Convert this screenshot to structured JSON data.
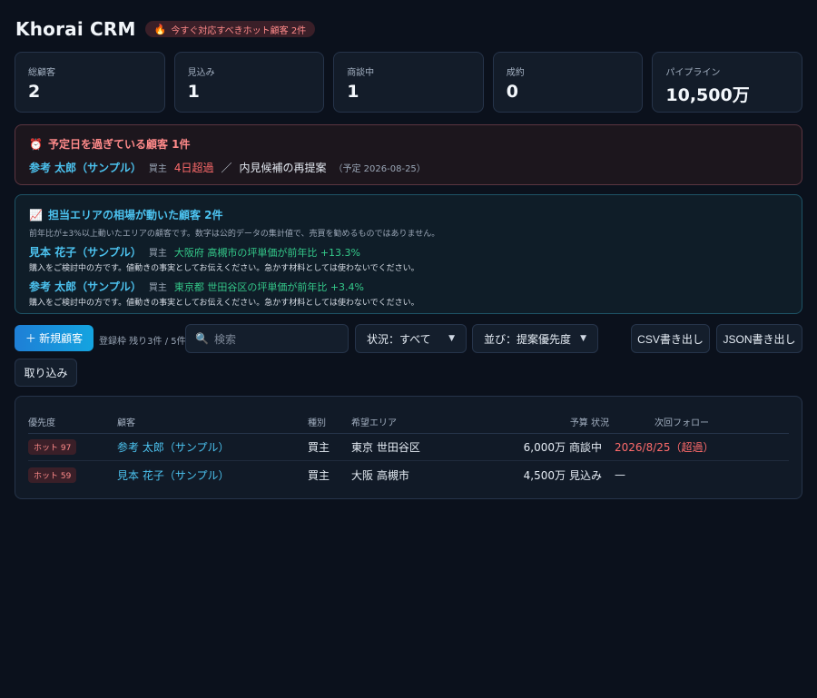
{
  "app": {
    "title": "Khorai CRM",
    "hot_badge": "今すぐ対応すべきホット顧客 2件"
  },
  "stats": [
    {
      "label": "総顧客",
      "value": "2"
    },
    {
      "label": "見込み",
      "value": "1"
    },
    {
      "label": "商談中",
      "value": "1"
    },
    {
      "label": "成約",
      "value": "0"
    },
    {
      "label": "パイプライン",
      "value": "10,500万"
    }
  ],
  "overdue": {
    "title": "予定日を過ぎている顧客 1件",
    "customer": "参考 太郎（サンプル）",
    "kind": "買主",
    "overdue_tag": "4日超過",
    "separator": "／",
    "action": "内見候補の再提案",
    "due": "（予定 2026-08-25）"
  },
  "market": {
    "title": "担当エリアの相場が動いた顧客 2件",
    "note": "前年比が±3%以上動いたエリアの顧客です。数字は公的データの集計値で、売買を勧めるものではありません。",
    "items": [
      {
        "customer": "見本 花子（サンプル）",
        "kind": "買主",
        "change": "大阪府 高槻市の坪単価が前年比 +13.3%",
        "sub": "購入をご検討中の方です。値動きの事実としてお伝えください。急かす材料としては使わないでください。"
      },
      {
        "customer": "参考 太郎（サンプル）",
        "kind": "買主",
        "change": "東京都 世田谷区の坪単価が前年比 +3.4%",
        "sub": "購入をご検討中の方です。値動きの事実としてお伝えください。急かす材料としては使わないでください。"
      }
    ]
  },
  "toolbar": {
    "new_customer": "＋ 新規顧客",
    "quota": "登録枠 残り3件 / 5件",
    "search_placeholder": "検索",
    "status_select": "状況：すべて",
    "sort_select": "並び：提案優先度",
    "csv_export": "CSV書き出し",
    "json_export": "JSON書き出し",
    "import": "取り込み"
  },
  "table": {
    "headers": {
      "priority": "優先度",
      "customer": "顧客",
      "kind": "種別",
      "area": "希望エリア",
      "budget_status": "予算 状況",
      "next_follow": "次回フォロー"
    },
    "rows": [
      {
        "priority": "ホット 97",
        "customer": "参考 太郎（サンプル）",
        "kind": "買主",
        "area": "東京 世田谷区",
        "budget": "6,000万",
        "status": "商談中",
        "next_follow": "2026/8/25（超過）"
      },
      {
        "priority": "ホット 59",
        "customer": "見本 花子（サンプル）",
        "kind": "買主",
        "area": "大阪 高槻市",
        "budget": "4,500万",
        "status": "見込み",
        "next_follow": "—"
      }
    ]
  },
  "colors": {
    "accent": "#4cc3f0",
    "danger": "#ff6b6b",
    "positive": "#34c98a",
    "background": "#0b111c"
  },
  "icons": {
    "hot": "flame-icon",
    "overdue": "alarm-clock-icon",
    "market": "chart-icon",
    "search": "search-icon"
  }
}
